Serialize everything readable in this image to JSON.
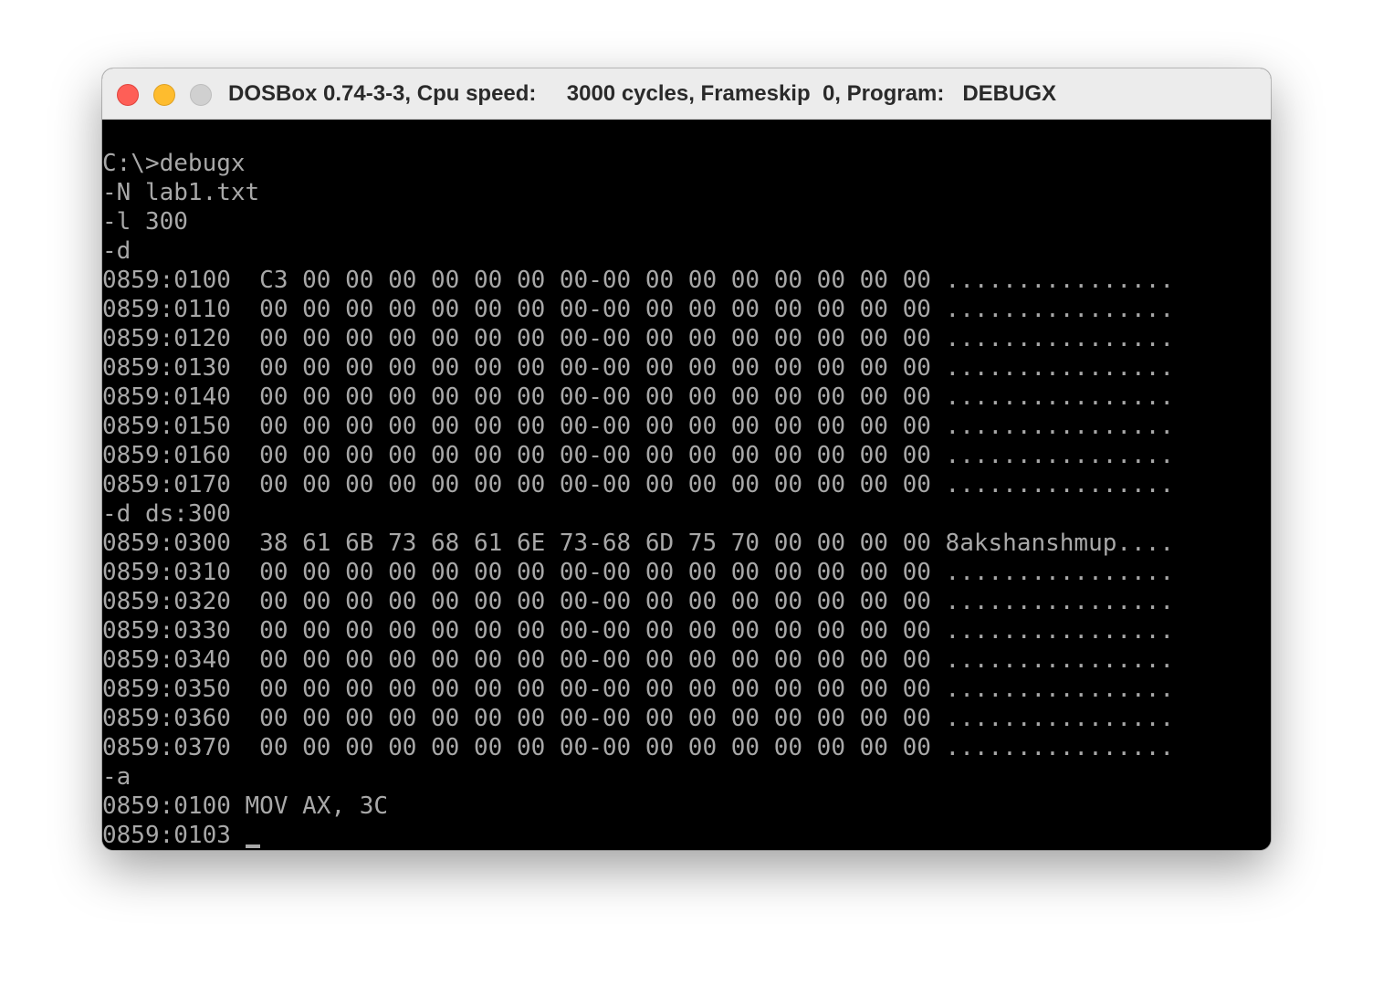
{
  "window": {
    "title": "DOSBox 0.74-3-3, Cpu speed:     3000 cycles, Frameskip  0, Program:   DEBUGX"
  },
  "colors": {
    "terminal_bg": "#000000",
    "terminal_fg": "#a8a8a8",
    "titlebar_bg": "#ececec",
    "close": "#fe5f57",
    "minimize": "#febc2e",
    "zoom_inactive": "#d0d0d0"
  },
  "terminal": {
    "lines": [
      "C:\\>debugx",
      "-N lab1.txt",
      "-l 300",
      "-d",
      "0859:0100  C3 00 00 00 00 00 00 00-00 00 00 00 00 00 00 00 ................",
      "0859:0110  00 00 00 00 00 00 00 00-00 00 00 00 00 00 00 00 ................",
      "0859:0120  00 00 00 00 00 00 00 00-00 00 00 00 00 00 00 00 ................",
      "0859:0130  00 00 00 00 00 00 00 00-00 00 00 00 00 00 00 00 ................",
      "0859:0140  00 00 00 00 00 00 00 00-00 00 00 00 00 00 00 00 ................",
      "0859:0150  00 00 00 00 00 00 00 00-00 00 00 00 00 00 00 00 ................",
      "0859:0160  00 00 00 00 00 00 00 00-00 00 00 00 00 00 00 00 ................",
      "0859:0170  00 00 00 00 00 00 00 00-00 00 00 00 00 00 00 00 ................",
      "-d ds:300",
      "0859:0300  38 61 6B 73 68 61 6E 73-68 6D 75 70 00 00 00 00 8akshanshmup....",
      "0859:0310  00 00 00 00 00 00 00 00-00 00 00 00 00 00 00 00 ................",
      "0859:0320  00 00 00 00 00 00 00 00-00 00 00 00 00 00 00 00 ................",
      "0859:0330  00 00 00 00 00 00 00 00-00 00 00 00 00 00 00 00 ................",
      "0859:0340  00 00 00 00 00 00 00 00-00 00 00 00 00 00 00 00 ................",
      "0859:0350  00 00 00 00 00 00 00 00-00 00 00 00 00 00 00 00 ................",
      "0859:0360  00 00 00 00 00 00 00 00-00 00 00 00 00 00 00 00 ................",
      "0859:0370  00 00 00 00 00 00 00 00-00 00 00 00 00 00 00 00 ................",
      "-a",
      "0859:0100 MOV AX, 3C"
    ],
    "current_prompt": "0859:0103 "
  }
}
